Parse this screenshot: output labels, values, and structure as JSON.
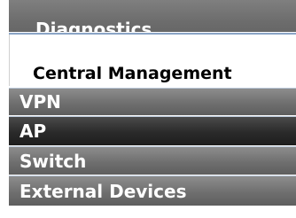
{
  "menu": {
    "diagnostics_label": "Diagnostics",
    "section_header": "Central Management",
    "items": [
      {
        "label": "VPN"
      },
      {
        "label": "AP"
      },
      {
        "label": "Switch"
      },
      {
        "label": "External Devices"
      }
    ],
    "selected": "AP"
  },
  "colors": {
    "item_gray": "#6f6f6f",
    "item_selected": "#2a2a2a",
    "divider": "#8aa4c6",
    "text_light": "#ffffff",
    "text_dark": "#000000"
  }
}
